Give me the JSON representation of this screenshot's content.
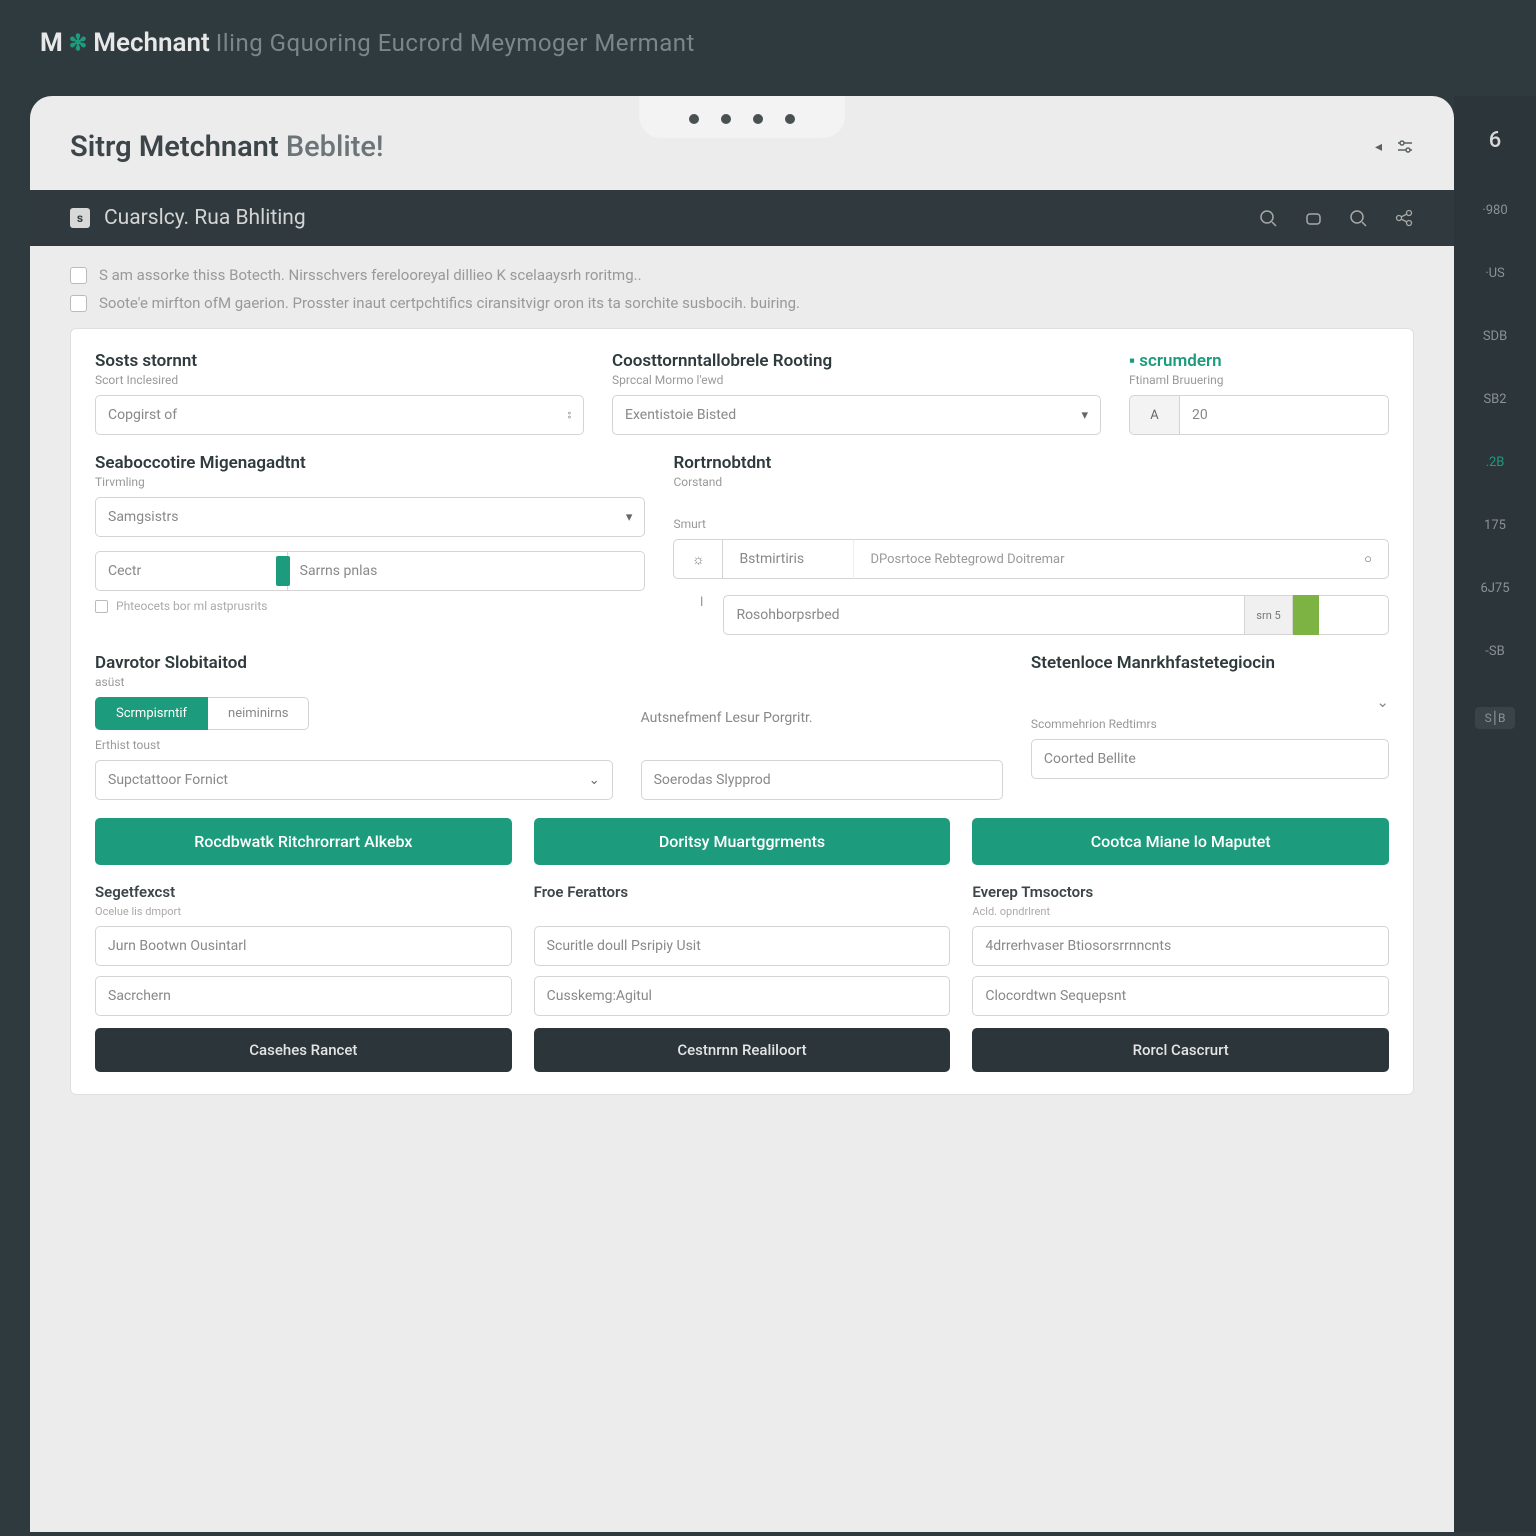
{
  "header": {
    "brand_m": "M",
    "brand_name": "Mechnant",
    "brand_tagline": "Iling Gquoring Eucrord Meymoger Mermant"
  },
  "page": {
    "title_strong": "Sitrg Metchnant",
    "title_light": "Beblite!"
  },
  "toolbar": {
    "title": "Cuarslcy. Rua Bhliting"
  },
  "notices": {
    "line1": "S am assorke thiss Botecth. Nirsschvers ferelooreyal dillieo K scelaaysrh roritmg..",
    "line2": "Soote'e mirfton ofM gaerion. Prosster inaut certpchtifics ciransitvigr oron its ta sorchite susbocih. buiring."
  },
  "form": {
    "sosts": {
      "title": "Sosts stornnt",
      "sub": "Scort Inclesired",
      "placeholder": "Copgirst of"
    },
    "coost": {
      "title": "Coosttornntallobrele Rooting",
      "sub": "Sprccal Mormo l'ewd",
      "placeholder": "Exentistoie Bisted"
    },
    "scrumden": {
      "title": "scrumdern",
      "sub": "Ftinaml Bruuering",
      "prefix": "A",
      "value": "20"
    },
    "seab": {
      "title": "Seaboccotire Migenagadtnt",
      "sub": "Tirvmling",
      "placeholder": "Samgsistrs"
    },
    "rortr": {
      "title": "Rortrnobtdnt",
      "sub": "Corstand",
      "sub2": "Smurt"
    },
    "cect": {
      "left": "Cectr",
      "right": "Sarrns pnlas"
    },
    "minicheck": "Phteocets bor ml astprusrits",
    "dbwide": {
      "prefix": "☼",
      "label": "Bstmirtiris",
      "value": "DPosrtoce Rebtegrowd Doitremar"
    },
    "badge": {
      "placeholder": "Rosohborpsrbed",
      "mid": "srn 5"
    },
    "davr": {
      "title": "Davrotor Slobitaitod",
      "sub": "asüst",
      "tab1": "Scrmpisrntif",
      "tab2": "neiminirns",
      "sub3": "Erthist toust",
      "placeholder3": "Supctattoor Fornict"
    },
    "aust": {
      "title": "Autsnefmenf Lesur Porgritr."
    },
    "stet": {
      "title": "Stetenloce Manrkhfastetegiocin",
      "sub": "Scommehrion Redtimrs",
      "input1": "Soerodas Slypprod",
      "input2": "Coorted Bellite"
    }
  },
  "actions": {
    "btn1": "Rocdbwatk Ritchrorrart Alkebx",
    "btn2": "Doritsy Muartggrments",
    "btn3": "Cootca Miane lo Maputet"
  },
  "cols": {
    "c1": {
      "heading": "Segetfexcst",
      "sub": "Ocelue lis dmport",
      "f1": "Jurn Bootwn Ousintarl",
      "f2": "Sacrchern",
      "dark": "Casehes Rancet"
    },
    "c2": {
      "heading": "Froe Ferattors",
      "f1": "Scuritle doull Psripiy Usit",
      "f2": "Cusskemg:Agitul",
      "dark": "Cestnrnn Realiloort"
    },
    "c3": {
      "heading": "Everep Tmsoctors",
      "sub": "Acld. opndrlrent",
      "f1": "4drrerhvaser Btiosorsrrnncnts",
      "f2": "Clocordtwn Sequepsnt",
      "dark": "Rorcl Cascrurt"
    }
  },
  "rail": {
    "top": "6",
    "items": [
      "·980",
      "·US",
      "SDB",
      "SB2",
      ".2B",
      "175",
      "6J75",
      "-SB",
      "S⎮B"
    ]
  }
}
